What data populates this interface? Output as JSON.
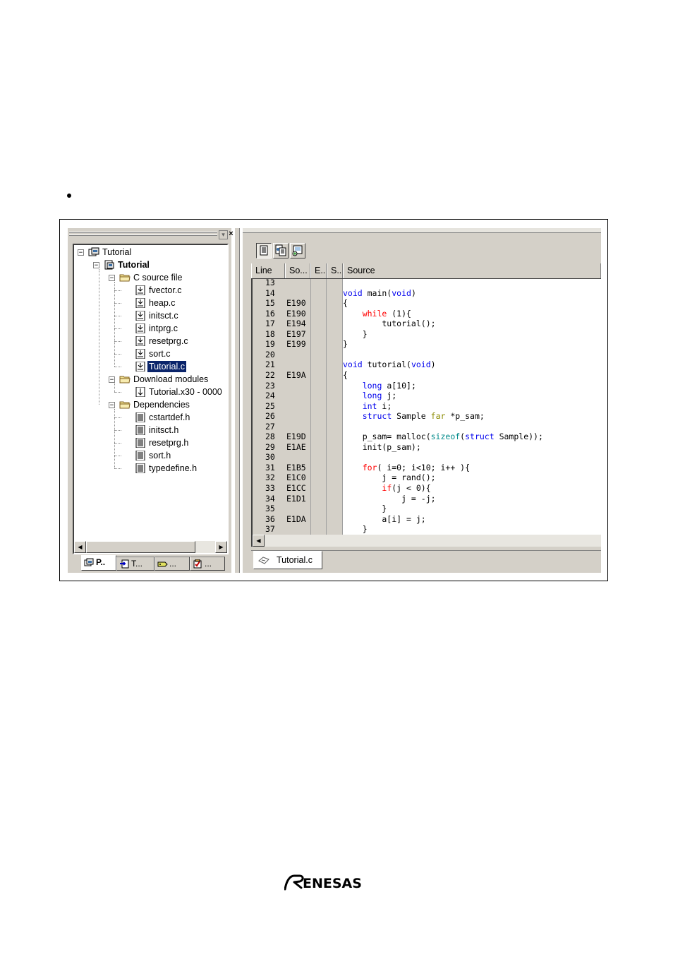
{
  "workspace": {
    "tree": [
      {
        "label": "Tutorial",
        "level": 0,
        "icon": "workspace-icon"
      },
      {
        "label": "Tutorial",
        "level": 1,
        "icon": "project-icon",
        "bold": true
      },
      {
        "label": "C source file",
        "level": 2,
        "icon": "folder-icon"
      },
      {
        "label": "fvector.c",
        "level": 3,
        "icon": "source-file-icon"
      },
      {
        "label": "heap.c",
        "level": 3,
        "icon": "source-file-icon"
      },
      {
        "label": "initsct.c",
        "level": 3,
        "icon": "source-file-icon"
      },
      {
        "label": "intprg.c",
        "level": 3,
        "icon": "source-file-icon"
      },
      {
        "label": "resetprg.c",
        "level": 3,
        "icon": "source-file-icon"
      },
      {
        "label": "sort.c",
        "level": 3,
        "icon": "source-file-icon"
      },
      {
        "label": "Tutorial.c",
        "level": 3,
        "icon": "source-file-icon",
        "selected": true
      },
      {
        "label": "Download modules",
        "level": 2,
        "icon": "folder-icon"
      },
      {
        "label": "Tutorial.x30 - 0000",
        "level": 3,
        "icon": "download-module-icon"
      },
      {
        "label": "Dependencies",
        "level": 2,
        "icon": "folder-icon"
      },
      {
        "label": "cstartdef.h",
        "level": 3,
        "icon": "header-file-icon"
      },
      {
        "label": "initsct.h",
        "level": 3,
        "icon": "header-file-icon"
      },
      {
        "label": "resetprg.h",
        "level": 3,
        "icon": "header-file-icon"
      },
      {
        "label": "sort.h",
        "level": 3,
        "icon": "header-file-icon"
      },
      {
        "label": "typedefine.h",
        "level": 3,
        "icon": "header-file-icon"
      }
    ],
    "tabs": [
      {
        "label": "P..",
        "icon": "projects-tab-icon",
        "active": true
      },
      {
        "label": "T...",
        "icon": "templates-tab-icon"
      },
      {
        "label": "...",
        "icon": "labels-tab-icon"
      },
      {
        "label": "...",
        "icon": "navigation-tab-icon"
      }
    ]
  },
  "editor": {
    "columns": [
      "Line",
      "So...",
      "E...",
      "S...",
      "Source"
    ],
    "rows": [
      {
        "line": "13",
        "addr": "",
        "src": ""
      },
      {
        "line": "14",
        "addr": "",
        "src": "<b>void</b> main(<b>void</b>)"
      },
      {
        "line": "15",
        "addr": "E190",
        "src": "{"
      },
      {
        "line": "16",
        "addr": "E190",
        "src": "    <r>while</r> (1){"
      },
      {
        "line": "17",
        "addr": "E194",
        "src": "        tutorial();"
      },
      {
        "line": "18",
        "addr": "E197",
        "src": "    }"
      },
      {
        "line": "19",
        "addr": "E199",
        "src": "}"
      },
      {
        "line": "20",
        "addr": "",
        "src": ""
      },
      {
        "line": "21",
        "addr": "",
        "src": "<b>void</b> tutorial(<b>void</b>)"
      },
      {
        "line": "22",
        "addr": "E19A",
        "src": "{"
      },
      {
        "line": "23",
        "addr": "",
        "src": "    <b>long</b> a[10];"
      },
      {
        "line": "24",
        "addr": "",
        "src": "    <b>long</b> j;"
      },
      {
        "line": "25",
        "addr": "",
        "src": "    <b>int</b> i;"
      },
      {
        "line": "26",
        "addr": "",
        "src": "    <b>struct</b> Sample <o>far</o> *p_sam;"
      },
      {
        "line": "27",
        "addr": "",
        "src": ""
      },
      {
        "line": "28",
        "addr": "E19D",
        "src": "    p_sam= malloc(<t>sizeof</t>(<b>struct</b> Sample));"
      },
      {
        "line": "29",
        "addr": "E1AE",
        "src": "    init(p_sam);"
      },
      {
        "line": "30",
        "addr": "",
        "src": ""
      },
      {
        "line": "31",
        "addr": "E1B5",
        "src": "    <r>for</r>( i=0; i<10; i++ ){"
      },
      {
        "line": "32",
        "addr": "E1C0",
        "src": "        j = rand();"
      },
      {
        "line": "33",
        "addr": "E1CC",
        "src": "        <r>if</r>(j < 0){"
      },
      {
        "line": "34",
        "addr": "E1D1",
        "src": "            j = -j;"
      },
      {
        "line": "35",
        "addr": "",
        "src": "        }"
      },
      {
        "line": "36",
        "addr": "E1DA",
        "src": "        a[i] = j;"
      },
      {
        "line": "37",
        "addr": "",
        "src": "    }"
      }
    ],
    "tab_label": "Tutorial.c"
  },
  "logo_text": "RENESAS",
  "colors": {
    "selection": "#0a246a",
    "keyword_blue": "#0000ee",
    "keyword_red": "#ff0000",
    "keyword_olive": "#8a8a00",
    "keyword_teal": "#008a8a",
    "chrome": "#d4d0c8"
  }
}
